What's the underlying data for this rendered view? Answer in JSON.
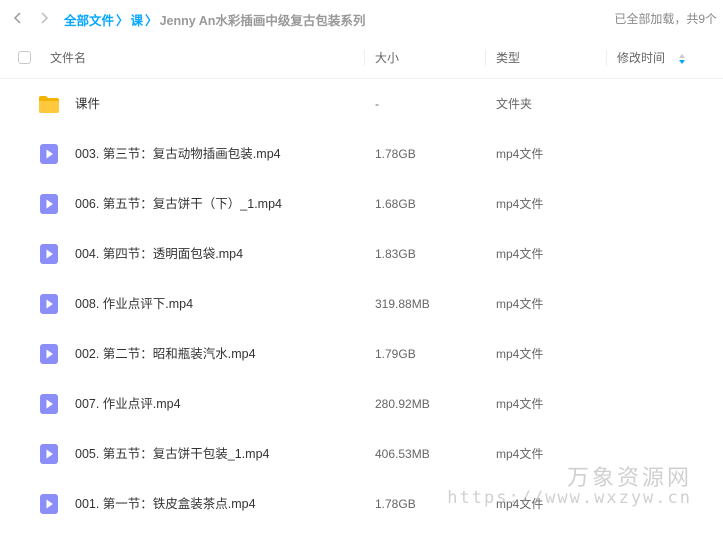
{
  "breadcrumb": {
    "root": "全部文件",
    "separator": "〉",
    "parent": "课",
    "current": "Jenny An水彩插画中级复古包装系列"
  },
  "status": {
    "loaded_text": "已全部加载，共9个"
  },
  "columns": {
    "name": "文件名",
    "size": "大小",
    "type": "类型",
    "modified": "修改时间"
  },
  "files": [
    {
      "name": "课件",
      "size": "-",
      "type": "文件夹",
      "icon": "folder-icon"
    },
    {
      "name": "003. 第三节：复古动物插画包装.mp4",
      "size": "1.78GB",
      "type": "mp4文件",
      "icon": "video-file-icon"
    },
    {
      "name": "006. 第五节：复古饼干（下）_1.mp4",
      "size": "1.68GB",
      "type": "mp4文件",
      "icon": "video-file-icon"
    },
    {
      "name": "004. 第四节：透明面包袋.mp4",
      "size": "1.83GB",
      "type": "mp4文件",
      "icon": "video-file-icon"
    },
    {
      "name": "008. 作业点评下.mp4",
      "size": "319.88MB",
      "type": "mp4文件",
      "icon": "video-file-icon"
    },
    {
      "name": "002. 第二节：昭和瓶装汽水.mp4",
      "size": "1.79GB",
      "type": "mp4文件",
      "icon": "video-file-icon"
    },
    {
      "name": "007. 作业点评.mp4",
      "size": "280.92MB",
      "type": "mp4文件",
      "icon": "video-file-icon"
    },
    {
      "name": "005. 第五节：复古饼干包装_1.mp4",
      "size": "406.53MB",
      "type": "mp4文件",
      "icon": "video-file-icon"
    },
    {
      "name": "001. 第一节：铁皮盒装茶点.mp4",
      "size": "1.78GB",
      "type": "mp4文件",
      "icon": "video-file-icon"
    }
  ],
  "watermark": {
    "line1": "万象资源网",
    "line2": "https://www.wxzyw.cn"
  },
  "colors": {
    "accent": "#06a7ff",
    "video_icon": "#8b8ef8",
    "folder": "#ffc83d"
  }
}
